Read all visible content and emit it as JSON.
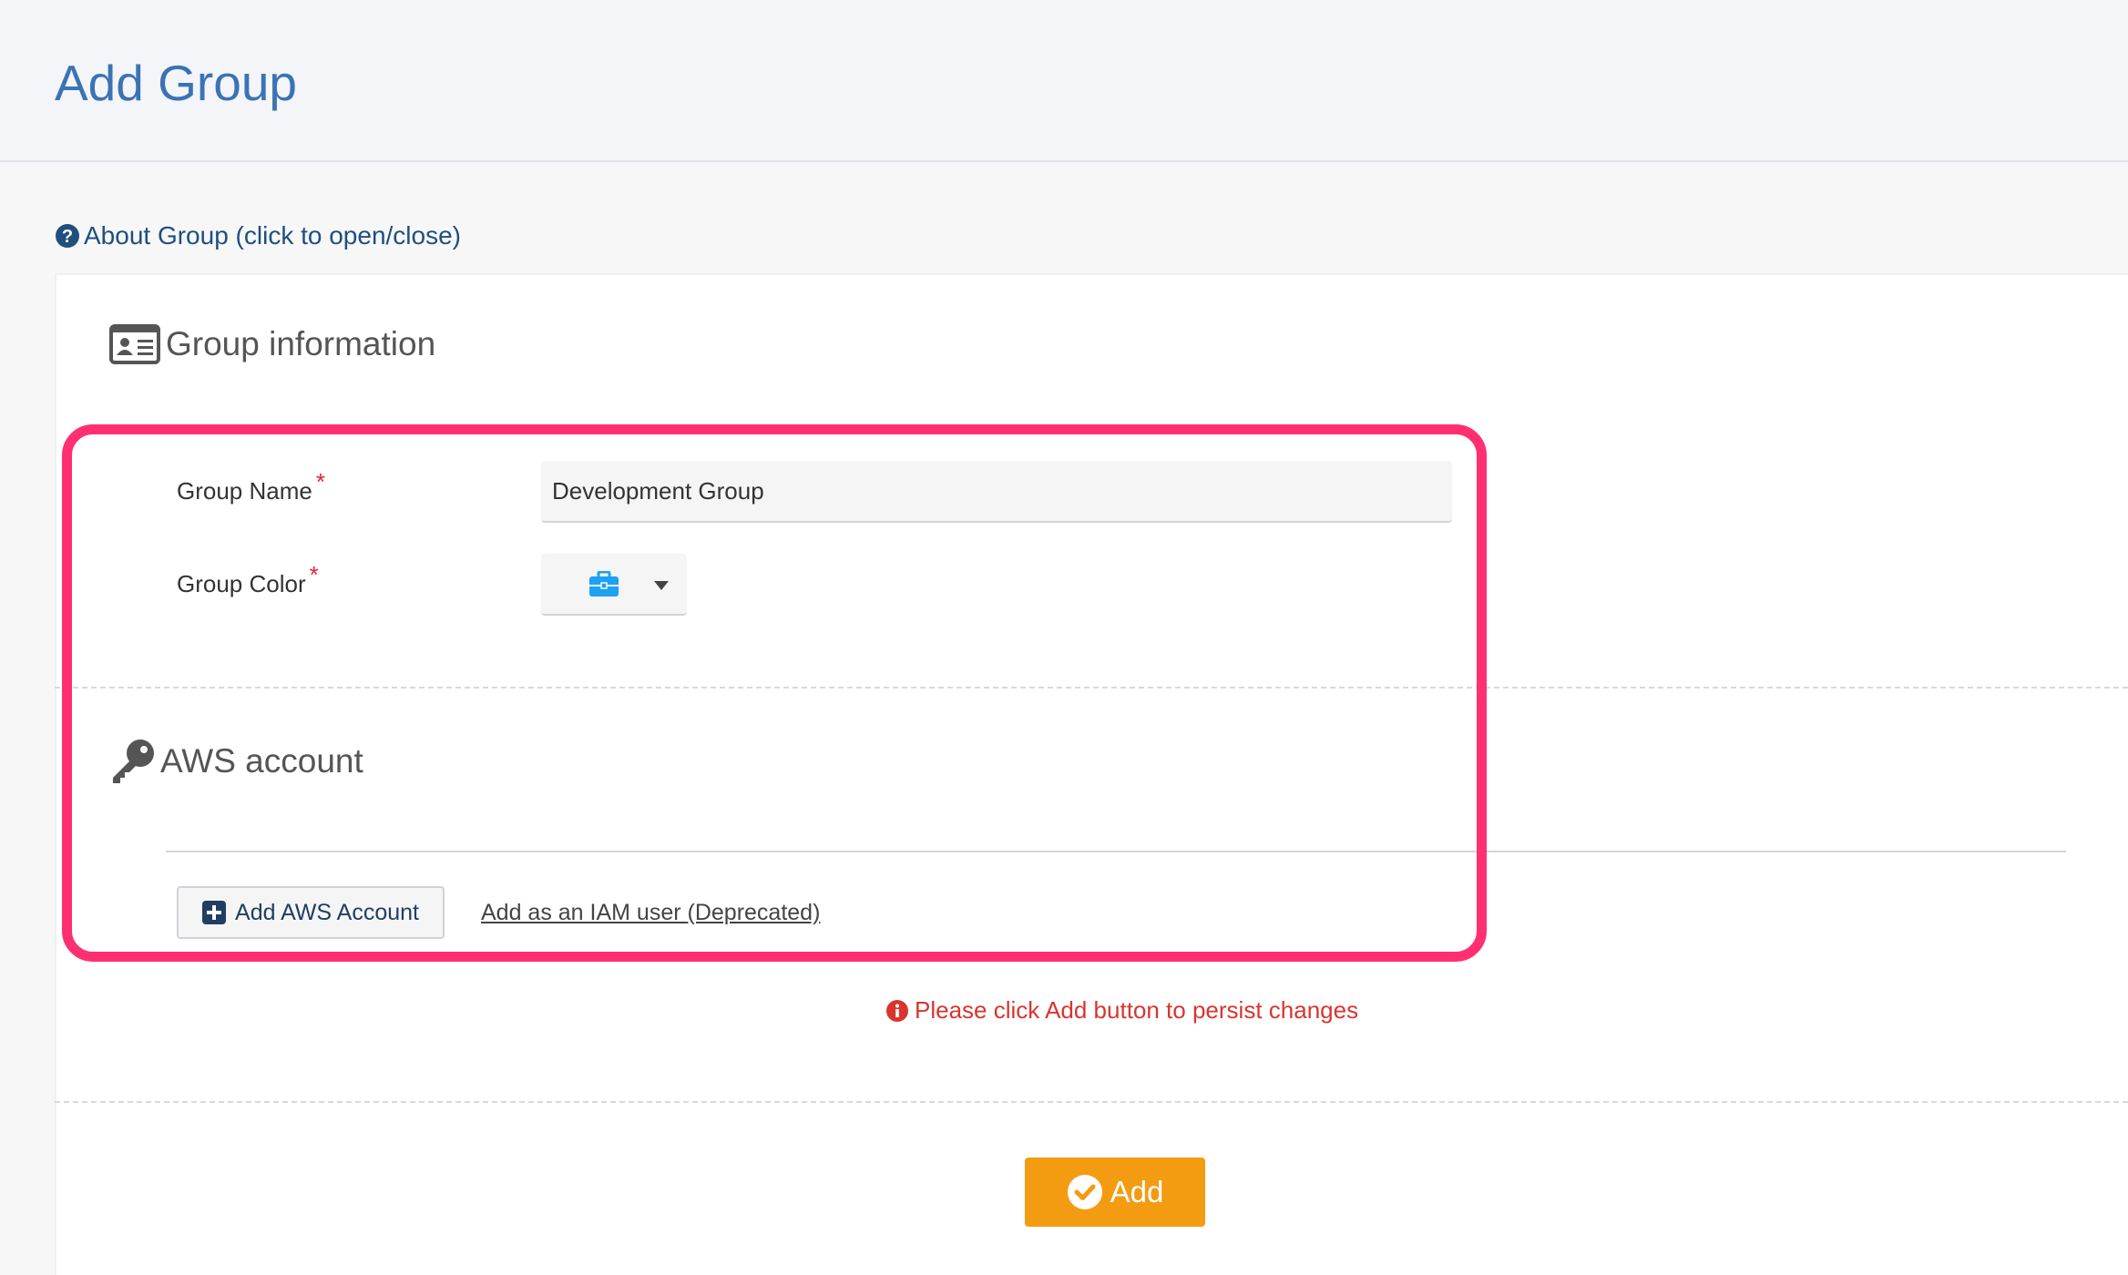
{
  "header": {
    "title": "Add Group"
  },
  "about": {
    "label": "About Group (click to open/close)",
    "icon": "question-circle-icon"
  },
  "group_information": {
    "heading": "Group information",
    "icon": "id-card-icon",
    "fields": {
      "group_name": {
        "label": "Group Name",
        "required_mark": "*",
        "value": "Development Group"
      },
      "group_color": {
        "label": "Group Color",
        "required_mark": "*",
        "selected_icon": "briefcase-icon",
        "selected_color": "#1da1f2"
      }
    }
  },
  "aws_account": {
    "heading": "AWS account",
    "icon": "key-icon",
    "add_button_label": "Add AWS Account",
    "iam_link_label": "Add as an IAM user (Deprecated)"
  },
  "warning": {
    "text": "Please click Add button to persist changes",
    "color": "#d9352e"
  },
  "footer": {
    "add_label": "Add",
    "accent": "#f39c12"
  },
  "highlight_color": "#ff2f72"
}
